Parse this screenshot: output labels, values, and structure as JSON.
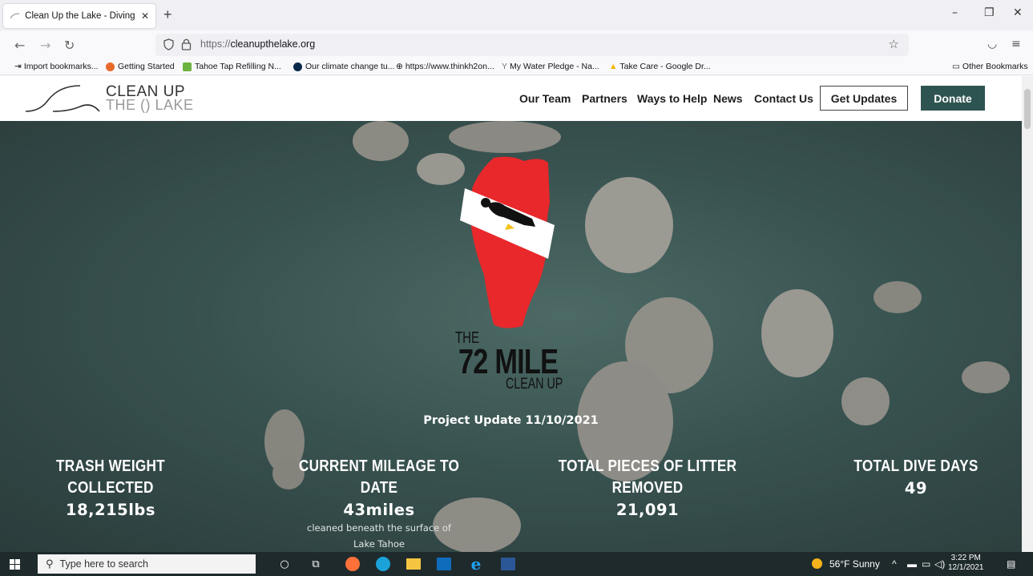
{
  "browser": {
    "tab_title": "Clean Up the Lake - Diving to C",
    "new_tab": "+",
    "url_scheme": "https://",
    "url_host": "cleanupthelake.org",
    "bookmarks": [
      "Import bookmarks...",
      "Getting Started",
      "Tahoe Tap Refilling N...",
      "Our climate change tu...",
      "https://www.thinkh2on...",
      "My Water Pledge - Na...",
      "Take Care - Google Dr...",
      "Other Bookmarks"
    ]
  },
  "site": {
    "logo_line1": "CLEAN UP",
    "logo_line2": "THE () LAKE",
    "nav": [
      "Our Team",
      "Partners",
      "Ways to Help",
      "News",
      "Contact Us"
    ],
    "get_updates": "Get Updates",
    "donate": "Donate",
    "emblem_the": "THE",
    "emblem_72": "72 MILE",
    "emblem_clean": "CLEAN UP",
    "project_update": "Project Update 11/10/2021",
    "stats": [
      {
        "label_1": "TRASH WEIGHT",
        "label_2": "COLLECTED",
        "value": "18,215lbs",
        "sub_1": "",
        "sub_2": ""
      },
      {
        "label_1": "CURRENT MILEAGE TO",
        "label_2": "DATE",
        "value": "43miles",
        "sub_1": "cleaned beneath the surface of",
        "sub_2": "Lake Tahoe"
      },
      {
        "label_1": "TOTAL PIECES OF LITTER",
        "label_2": "REMOVED",
        "value": "21,091",
        "sub_1": "",
        "sub_2": ""
      },
      {
        "label_1": "TOTAL DIVE DAYS",
        "label_2": "",
        "value": "49",
        "sub_1": "",
        "sub_2": ""
      }
    ]
  },
  "taskbar": {
    "search_placeholder": "Type here to search",
    "weather": "56°F  Sunny",
    "time": "3:22 PM",
    "date": "12/1/2021"
  },
  "colors": {
    "donate_bg": "#2e5451",
    "emblem_red": "#e8282b"
  }
}
